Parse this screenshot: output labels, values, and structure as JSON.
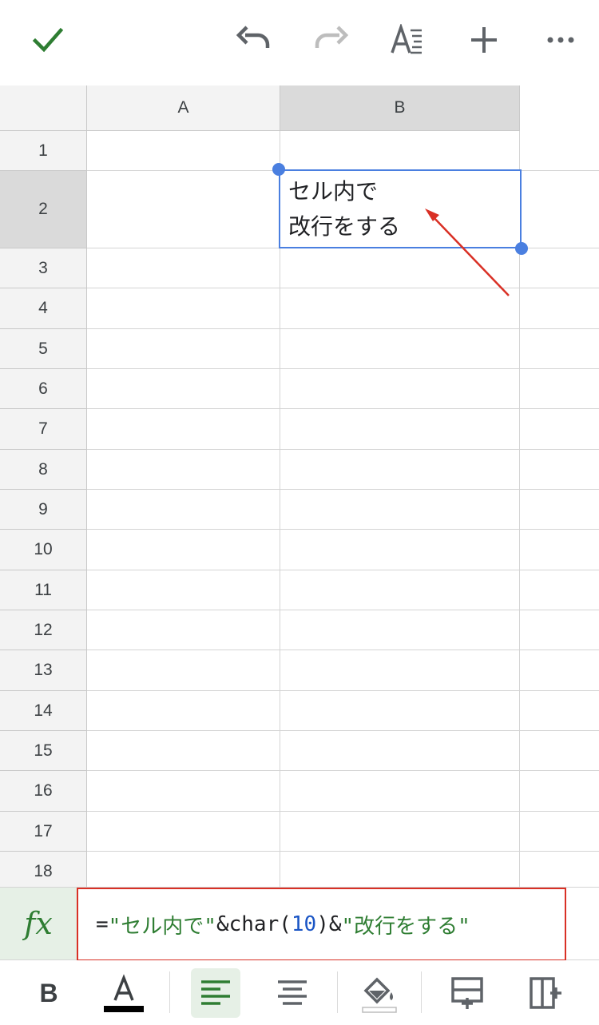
{
  "toolbar": {
    "icons": [
      "check-icon",
      "undo-icon",
      "redo-icon",
      "text-format-icon",
      "plus-icon",
      "more-icon"
    ],
    "accent": "#2e7d32"
  },
  "sheet": {
    "columns": [
      "A",
      "B"
    ],
    "rows": [
      "1",
      "2",
      "3",
      "4",
      "5",
      "6",
      "7",
      "8",
      "9",
      "10",
      "11",
      "12",
      "13",
      "14",
      "15",
      "16",
      "17",
      "18"
    ],
    "selected_column": "B",
    "selected_row": "2",
    "cell_b2_line1": "セル内で",
    "cell_b2_line2": "改行をする"
  },
  "formula_bar": {
    "fx_label": "fx",
    "eq": "=",
    "str1": "\"セル内で\"",
    "amp1": "&char(",
    "num": "10",
    "close_amp": ")&",
    "str2": "\"改行をする\""
  },
  "format_bar": {
    "bold_label": "B",
    "text_color": "#000000",
    "active_tool": "align-left",
    "icons": [
      "bold-icon",
      "text-color-icon",
      "align-left-icon",
      "align-center-icon",
      "fill-color-icon",
      "insert-row-icon",
      "insert-column-icon"
    ]
  },
  "colors": {
    "selection": "#4a7fe0",
    "annotation": "#d93025",
    "header_bg": "#f3f3f3",
    "header_selected_bg": "#dadada"
  }
}
